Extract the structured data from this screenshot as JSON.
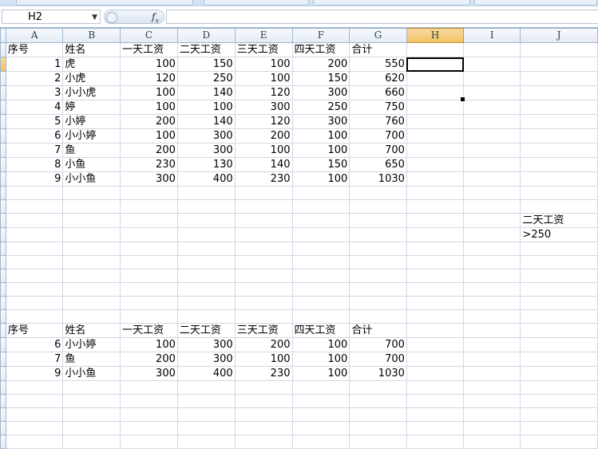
{
  "formula_bar": {
    "name_box": "H2",
    "formula": ""
  },
  "columns": [
    "A",
    "B",
    "C",
    "D",
    "E",
    "F",
    "G",
    "H",
    "I",
    "J"
  ],
  "selected_column": "H",
  "active_cell": "H2",
  "rows": [
    [
      "序号",
      "姓名",
      "一天工资",
      "二天工资",
      "三天工资",
      "四天工资",
      "合计",
      "",
      "",
      ""
    ],
    [
      "1",
      "虎",
      "100",
      "150",
      "100",
      "200",
      "550",
      "",
      "",
      ""
    ],
    [
      "2",
      "小虎",
      "120",
      "250",
      "100",
      "150",
      "620",
      "",
      "",
      ""
    ],
    [
      "3",
      "小小虎",
      "100",
      "140",
      "120",
      "300",
      "660",
      "",
      "",
      ""
    ],
    [
      "4",
      "婷",
      "100",
      "100",
      "300",
      "250",
      "750",
      "",
      "",
      ""
    ],
    [
      "5",
      "小婷",
      "200",
      "140",
      "120",
      "300",
      "760",
      "",
      "",
      ""
    ],
    [
      "6",
      "小小婷",
      "100",
      "300",
      "200",
      "100",
      "700",
      "",
      "",
      ""
    ],
    [
      "7",
      "鱼",
      "200",
      "300",
      "100",
      "100",
      "700",
      "",
      "",
      ""
    ],
    [
      "8",
      "小鱼",
      "230",
      "130",
      "140",
      "150",
      "650",
      "",
      "",
      ""
    ],
    [
      "9",
      "小小鱼",
      "300",
      "400",
      "230",
      "100",
      "1030",
      "",
      "",
      ""
    ],
    [
      "",
      "",
      "",
      "",
      "",
      "",
      "",
      "",
      "",
      ""
    ],
    [
      "",
      "",
      "",
      "",
      "",
      "",
      "",
      "",
      "",
      ""
    ],
    [
      "",
      "",
      "",
      "",
      "",
      "",
      "",
      "",
      "",
      "二天工资"
    ],
    [
      "",
      "",
      "",
      "",
      "",
      "",
      "",
      "",
      "",
      ">250"
    ],
    [
      "",
      "",
      "",
      "",
      "",
      "",
      "",
      "",
      "",
      ""
    ],
    [
      "",
      "",
      "",
      "",
      "",
      "",
      "",
      "",
      "",
      ""
    ],
    [
      "",
      "",
      "",
      "",
      "",
      "",
      "",
      "",
      "",
      ""
    ],
    [
      "",
      "",
      "",
      "",
      "",
      "",
      "",
      "",
      "",
      ""
    ],
    [
      "",
      "",
      "",
      "",
      "",
      "",
      "",
      "",
      "",
      ""
    ],
    [
      "",
      "",
      "",
      "",
      "",
      "",
      "",
      "",
      "",
      ""
    ],
    [
      "序号",
      "姓名",
      "一天工资",
      "二天工资",
      "三天工资",
      "四天工资",
      "合计",
      "",
      "",
      ""
    ],
    [
      "6",
      "小小婷",
      "100",
      "300",
      "200",
      "100",
      "700",
      "",
      "",
      ""
    ],
    [
      "7",
      "鱼",
      "200",
      "300",
      "100",
      "100",
      "700",
      "",
      "",
      ""
    ],
    [
      "9",
      "小小鱼",
      "300",
      "400",
      "230",
      "100",
      "1030",
      "",
      "",
      ""
    ],
    [
      "",
      "",
      "",
      "",
      "",
      "",
      "",
      "",
      "",
      ""
    ],
    [
      "",
      "",
      "",
      "",
      "",
      "",
      "",
      "",
      "",
      ""
    ],
    [
      "",
      "",
      "",
      "",
      "",
      "",
      "",
      "",
      "",
      ""
    ],
    [
      "",
      "",
      "",
      "",
      "",
      "",
      "",
      "",
      "",
      ""
    ],
    [
      "",
      "",
      "",
      "",
      "",
      "",
      "",
      "",
      "",
      ""
    ]
  ],
  "colors": {
    "selected_header": "#f1c15f",
    "grid_line": "#d0d7e5",
    "header_bg": "#e4ebf5"
  }
}
